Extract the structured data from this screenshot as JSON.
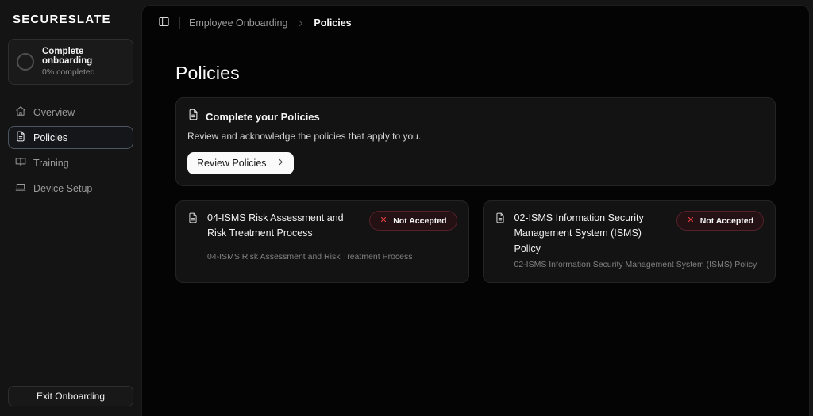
{
  "brand": {
    "logo": "SECURESLATE"
  },
  "sidebar": {
    "progress": {
      "title": "Complete onboarding",
      "subtitle": "0% completed"
    },
    "items": [
      {
        "label": "Overview",
        "icon": "home-icon",
        "selected": false
      },
      {
        "label": "Policies",
        "icon": "file-text-icon",
        "selected": true
      },
      {
        "label": "Training",
        "icon": "book-open-icon",
        "selected": false
      },
      {
        "label": "Device Setup",
        "icon": "laptop-icon",
        "selected": false
      }
    ],
    "exit_label": "Exit Onboarding"
  },
  "breadcrumb": {
    "parent": "Employee Onboarding",
    "current": "Policies"
  },
  "page": {
    "title": "Policies"
  },
  "cta_card": {
    "title": "Complete your Policies",
    "description": "Review and acknowledge the policies that apply to you.",
    "button_label": "Review Policies"
  },
  "policies": [
    {
      "title": "04-ISMS Risk Assessment and Risk Treatment Process",
      "subtitle": "04-ISMS Risk Assessment and Risk Treatment Process",
      "status": "Not Accepted"
    },
    {
      "title": "02-ISMS Information Security Management System (ISMS) Policy",
      "subtitle": "02-ISMS Information Security Management System (ISMS) Policy",
      "status": "Not Accepted"
    }
  ],
  "colors": {
    "status_red": "#ef4444",
    "badge_bg": "#231114",
    "badge_border": "#55212a",
    "panel_bg": "#040404",
    "frame_bg": "#141414",
    "card_bg": "#131313",
    "selected_border": "#4d5660"
  }
}
